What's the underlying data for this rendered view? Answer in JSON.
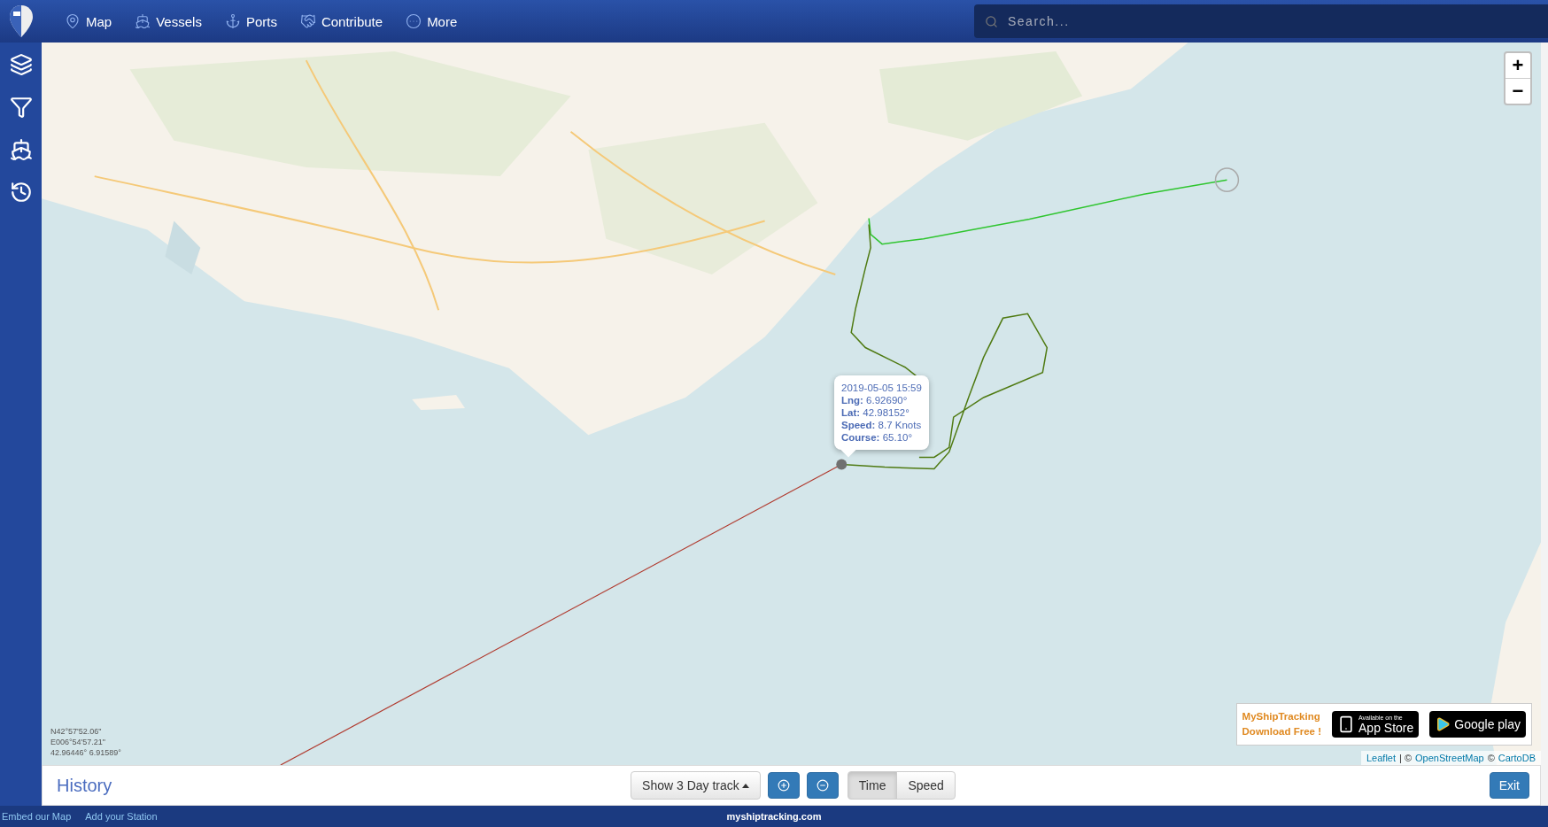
{
  "nav": [
    {
      "label": "Map"
    },
    {
      "label": "Vessels"
    },
    {
      "label": "Ports"
    },
    {
      "label": "Contribute"
    },
    {
      "label": "More"
    }
  ],
  "search": {
    "placeholder": "Search..."
  },
  "zoom": {
    "in": "+",
    "out": "−"
  },
  "popup": {
    "time": "2019-05-05 15:59",
    "lines": [
      "**Lng:** 6.92690°",
      "**Lat:** 42.98152°",
      "**Speed:** 8.7 Knots",
      "**Course:** 65.10°"
    ]
  },
  "cursor_coords": [
    "N42°57'52.06\"",
    "E006°54'57.21\"",
    "42.96446° 6.91589°"
  ],
  "promo": {
    "title": "MyShipTracking",
    "subtitle": "Download Free !",
    "badges": [
      {
        "kind": "apple",
        "small": "Available on the",
        "big": "App Store"
      },
      {
        "kind": "google",
        "big": "Google play"
      }
    ]
  },
  "attribution": [
    {
      "text": "Leaflet",
      "kind": "link"
    },
    {
      "text": "| ©",
      "kind": "text"
    },
    {
      "text": "OpenStreetMap",
      "kind": "link"
    },
    {
      "text": "©",
      "kind": "text"
    },
    {
      "text": "CartoDB",
      "kind": "link"
    }
  ],
  "history": {
    "title": "History",
    "track_button": "Show 3 Day track",
    "modes": [
      {
        "label": "Time",
        "selected": true
      },
      {
        "label": "Speed",
        "selected": false
      }
    ],
    "exit": "Exit"
  },
  "footer": {
    "links": [
      "Embed our Map",
      "Add your Station"
    ],
    "site": "myshiptracking.com"
  }
}
